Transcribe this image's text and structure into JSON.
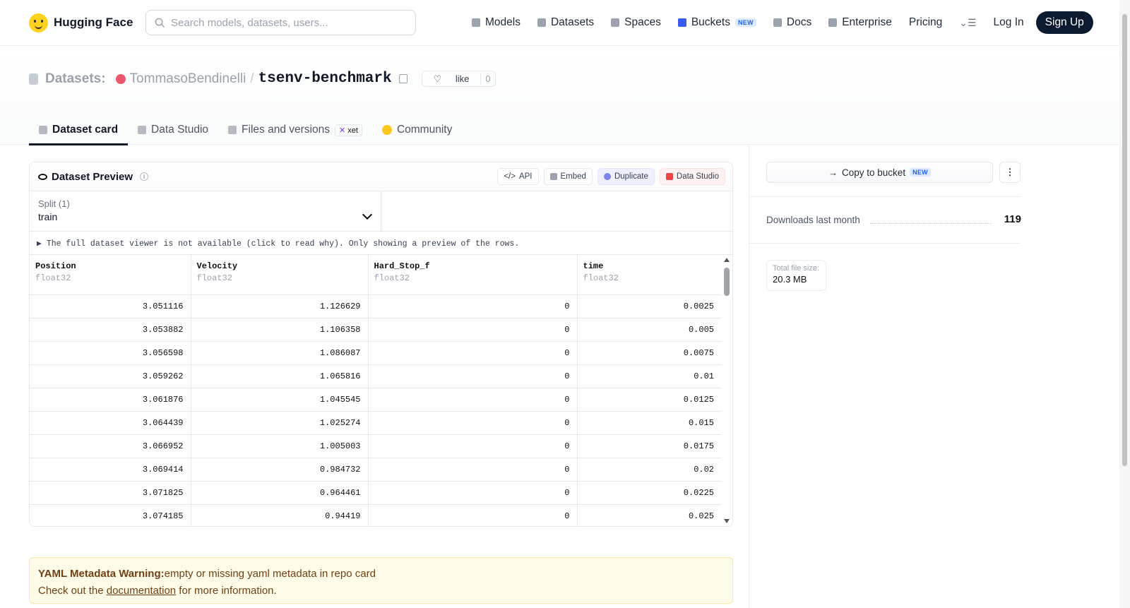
{
  "header": {
    "brand": "Hugging Face",
    "search_placeholder": "Search models, datasets, users...",
    "nav": [
      {
        "label": "Models"
      },
      {
        "label": "Datasets"
      },
      {
        "label": "Spaces"
      },
      {
        "label": "Buckets",
        "badge": "NEW"
      },
      {
        "label": "Docs"
      },
      {
        "label": "Enterprise"
      },
      {
        "label": "Pricing"
      }
    ],
    "login": "Log In",
    "signup": "Sign Up"
  },
  "repo": {
    "section": "Datasets:",
    "owner": "TommasoBendinelli",
    "separator": "/",
    "name": "tsenv-benchmark",
    "like_label": "like",
    "like_count": "0"
  },
  "tabs": [
    {
      "label": "Dataset card",
      "active": true
    },
    {
      "label": "Data Studio"
    },
    {
      "label": "Files and versions",
      "badge": "xet"
    },
    {
      "label": "Community"
    }
  ],
  "preview": {
    "title": "Dataset Preview",
    "buttons": {
      "api": "API",
      "embed": "Embed",
      "duplicate": "Duplicate",
      "data_studio": "Data Studio"
    },
    "split_label": "Split (1)",
    "split_value": "train",
    "notice": "▶ The full dataset viewer is not available (click to read why). Only showing a preview of the rows.",
    "columns": [
      {
        "name": "Position",
        "dtype": "float32"
      },
      {
        "name": "Velocity",
        "dtype": "float32"
      },
      {
        "name": "Hard_Stop_f",
        "dtype": "float32"
      },
      {
        "name": "time",
        "dtype": "float32"
      }
    ],
    "rows": [
      [
        "3.051116",
        "1.126629",
        "0",
        "0.0025"
      ],
      [
        "3.053882",
        "1.106358",
        "0",
        "0.005"
      ],
      [
        "3.056598",
        "1.086087",
        "0",
        "0.0075"
      ],
      [
        "3.059262",
        "1.065816",
        "0",
        "0.01"
      ],
      [
        "3.061876",
        "1.045545",
        "0",
        "0.0125"
      ],
      [
        "3.064439",
        "1.025274",
        "0",
        "0.015"
      ],
      [
        "3.066952",
        "1.005003",
        "0",
        "0.0175"
      ],
      [
        "3.069414",
        "0.984732",
        "0",
        "0.02"
      ],
      [
        "3.071825",
        "0.964461",
        "0",
        "0.0225"
      ],
      [
        "3.074185",
        "0.94419",
        "0",
        "0.025"
      ]
    ]
  },
  "warning": {
    "title": "YAML Metadata Warning:",
    "text": "empty or missing yaml metadata in repo card",
    "prefix": "Check out the ",
    "link": "documentation",
    "suffix": " for more information."
  },
  "sidebar": {
    "copy_label": "Copy to bucket",
    "copy_badge": "NEW",
    "downloads_label": "Downloads last month",
    "downloads_value": "119",
    "size_label": "Total file size:",
    "size_value": "20.3 MB"
  }
}
